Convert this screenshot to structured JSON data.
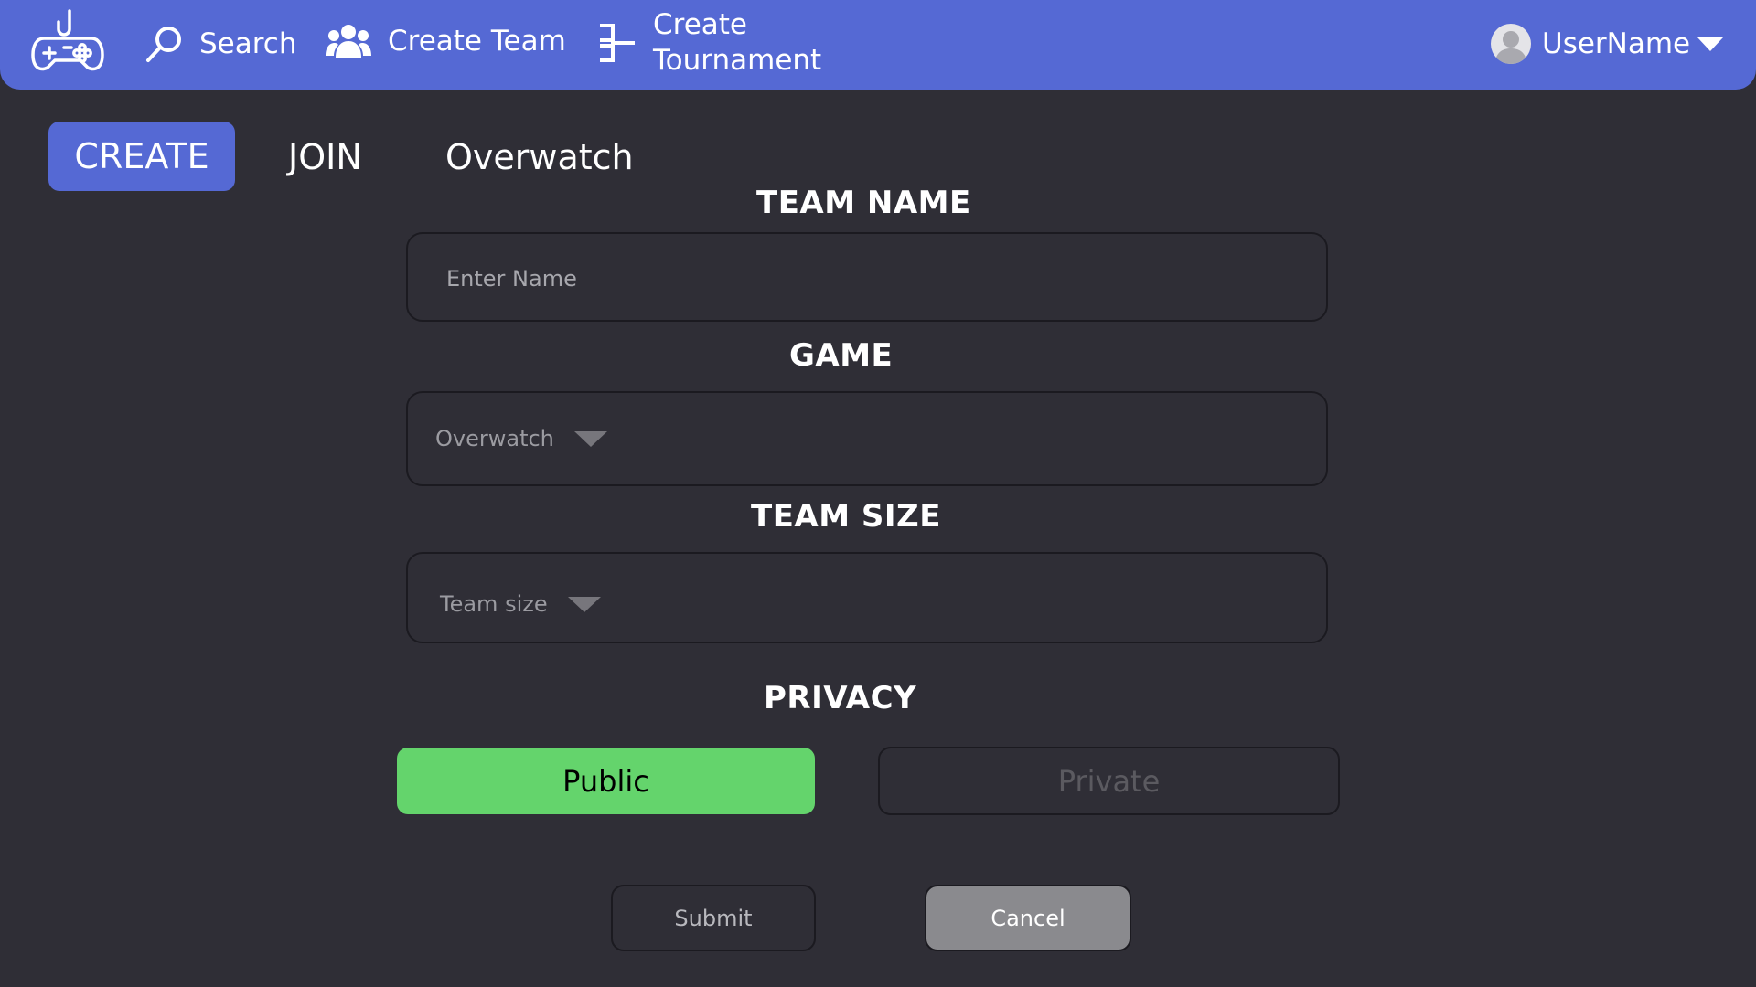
{
  "nav": {
    "search_label": "Search",
    "create_team_label": "Create Team",
    "create_tournament_label": "Create\nTournament",
    "username": "UserName"
  },
  "tabs": {
    "create": "CREATE",
    "join": "JOIN",
    "game": "Overwatch"
  },
  "form": {
    "team_name_label": "TEAM NAME",
    "team_name_placeholder": "Enter Name",
    "game_label": "GAME",
    "game_value": "Overwatch",
    "team_size_label": "TEAM SIZE",
    "team_size_value": "Team size",
    "privacy_label": "PRIVACY",
    "public_label": "Public",
    "private_label": "Private",
    "submit_label": "Submit",
    "cancel_label": "Cancel"
  },
  "colors": {
    "navbar": "#5569d4",
    "background": "#2f2e36",
    "public_selected": "#64d46c",
    "cancel": "#8a8a8e"
  },
  "icons": {
    "logo": "gamepad-icon",
    "search": "search-icon",
    "team": "users-icon",
    "tournament": "bracket-icon",
    "avatar": "user-avatar-icon"
  }
}
